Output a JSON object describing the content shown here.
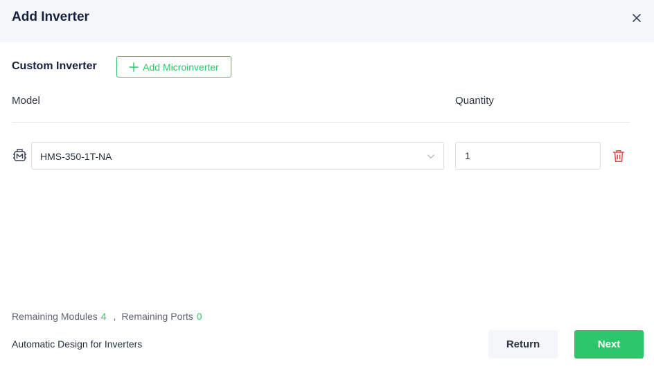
{
  "dialog": {
    "title": "Add Inverter",
    "close_icon": "close-icon"
  },
  "custom_section": {
    "title": "Custom Inverter",
    "add_button_label": "Add Microinverter",
    "add_button_icon": "plus-icon"
  },
  "table": {
    "columns": [
      "Model",
      "Quantity"
    ],
    "rows": [
      {
        "icon": "microinverter-icon",
        "model": "HMS-350-1T-NA",
        "quantity": "1",
        "delete_icon": "trash-icon"
      }
    ]
  },
  "summary": {
    "remaining_modules_label": "Remaining Modules",
    "remaining_modules_value": "4",
    "separator": ",",
    "remaining_ports_label": "Remaining Ports",
    "remaining_ports_value": "0"
  },
  "footer": {
    "auto_design_label": "Automatic Design for Inverters",
    "return_label": "Return",
    "next_label": "Next"
  },
  "colors": {
    "accent": "#2ec66b",
    "danger": "#e5484d",
    "header_bg": "#f4f6f9"
  }
}
